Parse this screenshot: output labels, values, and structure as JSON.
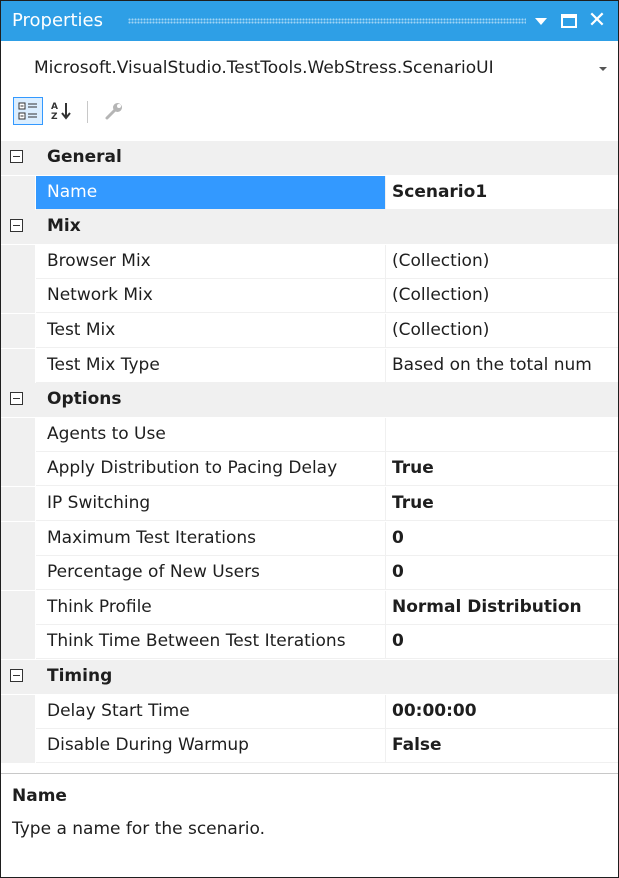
{
  "window": {
    "title": "Properties"
  },
  "object_selector": {
    "value": "Microsoft.VisualStudio.TestTools.WebStress.ScenarioUI"
  },
  "toolbar": {
    "categorized_icon": "categorized-icon",
    "alphabetical_icon": "alphabetical-icon",
    "property_pages_icon": "wrench-icon"
  },
  "colors": {
    "title_bar": "#2e9fe6",
    "selection": "#3399ff",
    "category_bg": "#f0f0f0"
  },
  "categories": [
    {
      "label": "General",
      "rows": [
        {
          "name": "Name",
          "value": "Scenario1",
          "bold": true,
          "selected": true
        }
      ]
    },
    {
      "label": "Mix",
      "rows": [
        {
          "name": "Browser Mix",
          "value": "(Collection)",
          "bold": false
        },
        {
          "name": "Network Mix",
          "value": "(Collection)",
          "bold": false
        },
        {
          "name": "Test Mix",
          "value": "(Collection)",
          "bold": false
        },
        {
          "name": "Test Mix Type",
          "value": "Based on the total num",
          "bold": false
        }
      ]
    },
    {
      "label": "Options",
      "rows": [
        {
          "name": "Agents to Use",
          "value": "",
          "bold": false
        },
        {
          "name": "Apply Distribution to Pacing Delay",
          "value": "True",
          "bold": true
        },
        {
          "name": "IP Switching",
          "value": "True",
          "bold": true
        },
        {
          "name": "Maximum Test Iterations",
          "value": "0",
          "bold": true
        },
        {
          "name": "Percentage of New Users",
          "value": "0",
          "bold": true
        },
        {
          "name": "Think Profile",
          "value": "Normal Distribution",
          "bold": true
        },
        {
          "name": "Think Time Between Test Iterations",
          "value": "0",
          "bold": true
        }
      ]
    },
    {
      "label": "Timing",
      "rows": [
        {
          "name": "Delay Start Time",
          "value": "00:00:00",
          "bold": true
        },
        {
          "name": "Disable During Warmup",
          "value": "False",
          "bold": true
        }
      ]
    }
  ],
  "description": {
    "title": "Name",
    "text": "Type a name for the scenario."
  }
}
